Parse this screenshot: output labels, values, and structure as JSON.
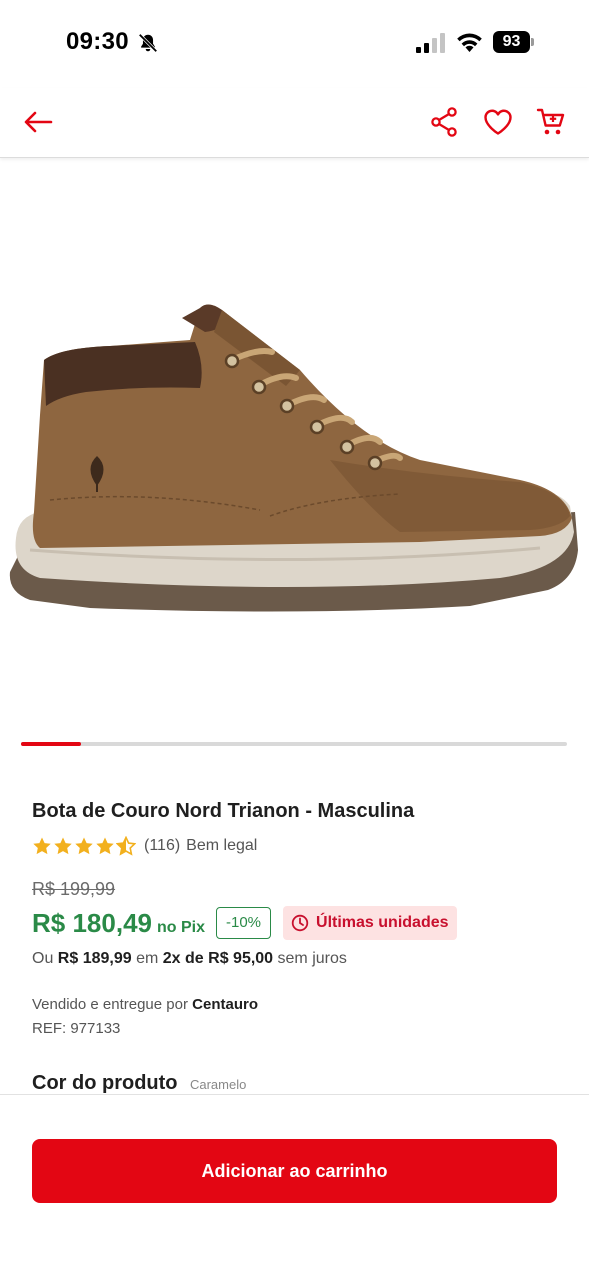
{
  "status_bar": {
    "time": "09:30",
    "battery": "93"
  },
  "nav": {
    "icons": [
      "back-arrow-icon",
      "share-icon",
      "heart-icon",
      "cart-icon"
    ]
  },
  "carousel": {
    "current_index": 1,
    "progress": 0.11
  },
  "product": {
    "title": "Bota de Couro Nord Trianon - Masculina",
    "rating_value": 4.5,
    "rating_count": "(116)",
    "rating_label": "Bem legal",
    "old_price": "R$ 199,99",
    "pix_price": "R$ 180,49",
    "pix_label": "no Pix",
    "discount": "-10%",
    "stock_badge": "Últimas unidades",
    "installments": {
      "prefix": "Ou",
      "price": "R$ 189,99",
      "middle": "em",
      "plan": "2x de R$ 95,00",
      "suffix": "sem juros"
    },
    "seller_prefix": "Vendido e entregue por",
    "seller_name": "Centauro",
    "ref": "REF: 977133",
    "color_title": "Cor do produto",
    "color_value": "Caramelo"
  },
  "actions": {
    "add_to_cart": "Adicionar ao carrinho"
  },
  "colors": {
    "brand_red": "#e30613",
    "price_green": "#2a8a47",
    "star_gold": "#f2b01e",
    "stock_bg": "#fde2e2"
  }
}
